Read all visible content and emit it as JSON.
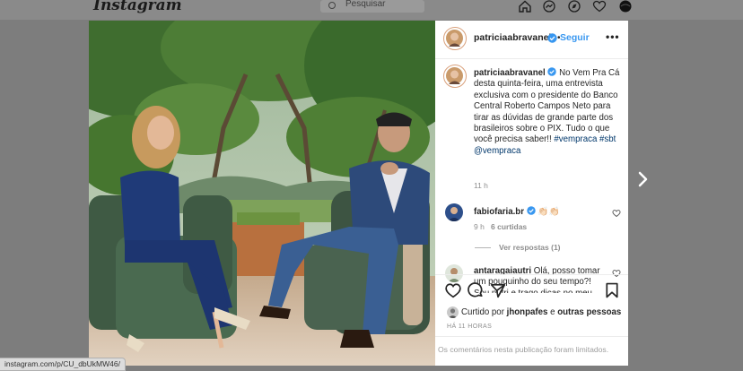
{
  "nav": {
    "logo": "Instagram",
    "search_placeholder": "Pesquisar"
  },
  "header": {
    "username": "patriciaabravanel",
    "follow_label": "Seguir"
  },
  "caption": {
    "username": "patriciaabravanel",
    "text": "No Vem Pra Cá desta quinta-feira, uma entrevista exclusiva com o presidente do Banco Central Roberto Campos Neto para tirar as dúvidas de grande parte dos brasileiros sobre o PIX. Tudo o que você precisa saber!!",
    "hashtags": "#vempraca #sbt",
    "mention": "@vempraca",
    "time": "11 h"
  },
  "comments": [
    {
      "username": "fabiofaria.br",
      "text": "👏🏻👏🏻",
      "time": "9 h",
      "likes": "6 curtidas",
      "view_replies": "Ver respostas (1)"
    },
    {
      "username": "antaragaiautri",
      "text": "Olá, posso tomar um pouquinho do seu tempo?! Sou nutri e trago dicas no meu insta"
    }
  ],
  "likes": {
    "prefix": "Curtido por",
    "user": "jhonpafes",
    "connector": "e",
    "others": "outras pessoas"
  },
  "post_time": "HÁ 11 HORAS",
  "comments_limited": "Os comentários nesta publicação foram limitados.",
  "status_url": "instagram.com/p/CU_dbUkMW46/",
  "colors": {
    "link_blue": "#3897f0",
    "overlay": "#7d7d7d",
    "verified": "#3897f0"
  },
  "icons": [
    "home-icon",
    "messenger-icon",
    "explore-icon",
    "heart-icon",
    "profile-icon",
    "search-icon",
    "more-icon",
    "comment-icon",
    "share-icon",
    "bookmark-icon",
    "chevron-right-icon",
    "verified-icon"
  ]
}
